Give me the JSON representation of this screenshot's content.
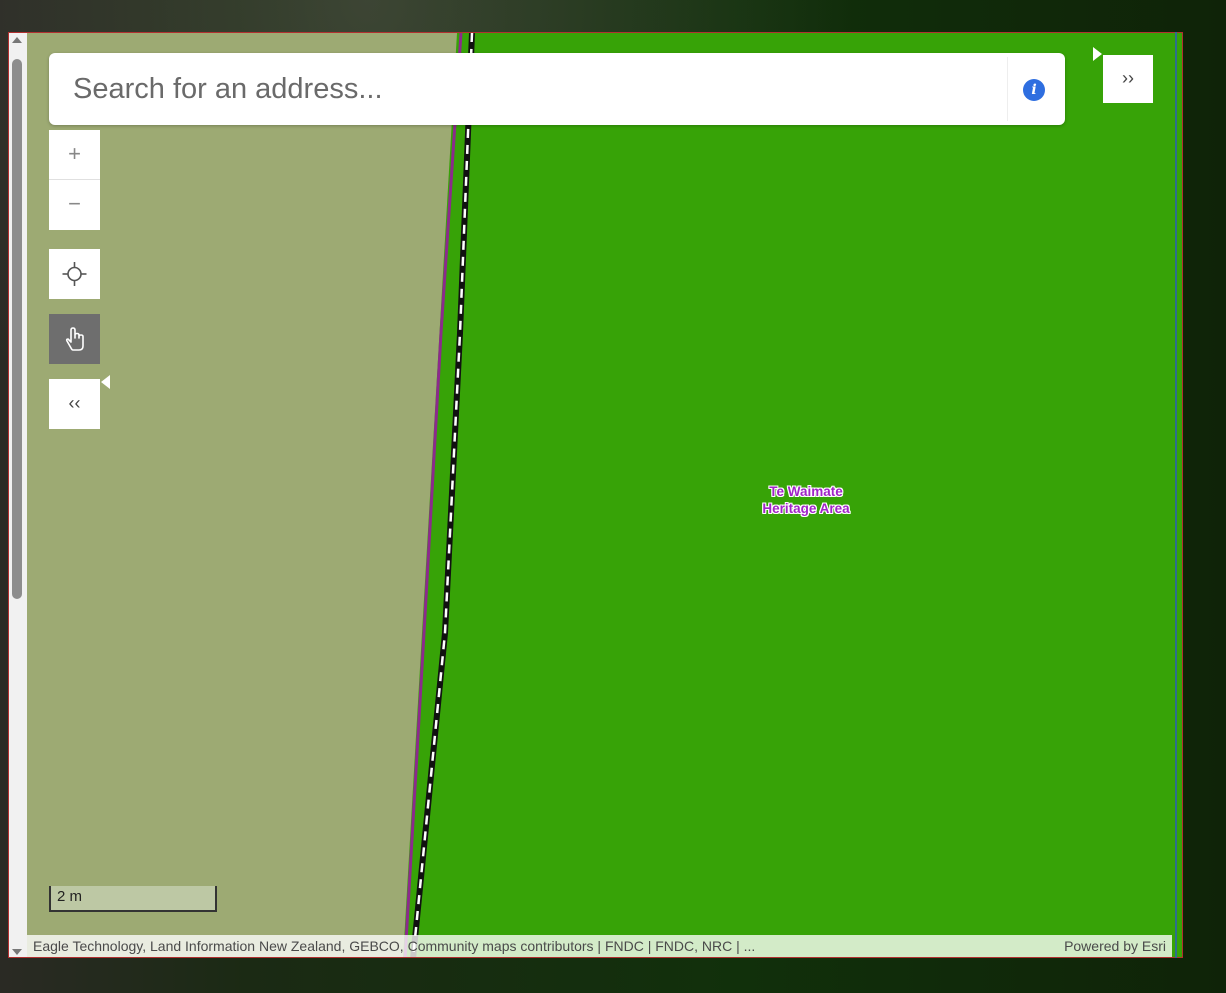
{
  "search": {
    "placeholder": "Search for an address..."
  },
  "controls": {
    "zoom_in": "+",
    "zoom_out": "−",
    "expand": "››",
    "collapse": "‹‹"
  },
  "map": {
    "label_line1": "Te Waimate",
    "label_line2": "Heritage Area",
    "scale": "2 m",
    "colors": {
      "heritage_area": "#37a307",
      "land": "#9daa73",
      "boundary": "#8c2a8c",
      "label": "#a024c8"
    }
  },
  "attribution": {
    "text": "Eagle Technology, Land Information New Zealand, GEBCO, Community maps contributors | FNDC | FNDC, NRC | ...",
    "powered_by": "Powered by Esri"
  },
  "icons": [
    "info-icon",
    "locate-icon",
    "pan-hand-icon",
    "expand-icon",
    "collapse-icon"
  ]
}
